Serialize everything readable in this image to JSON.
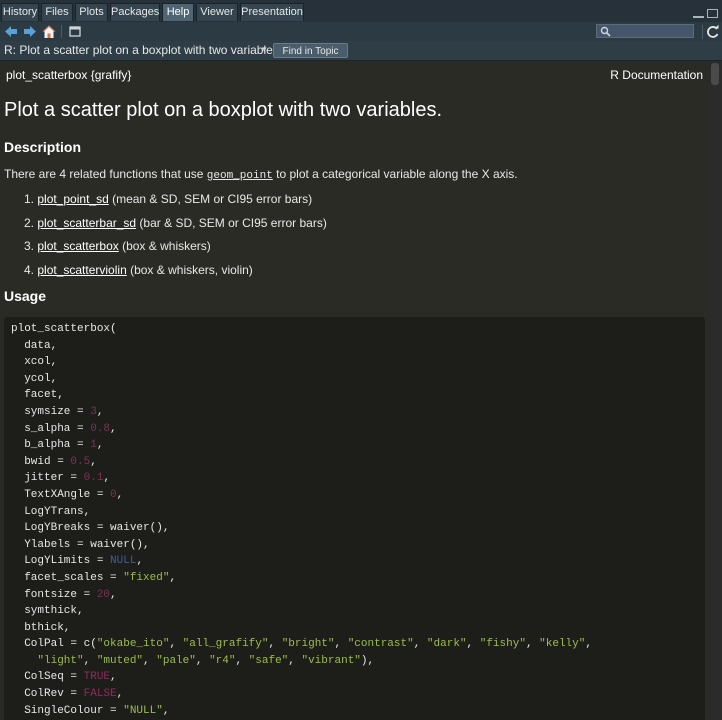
{
  "tabs": [
    {
      "label": "History",
      "active": false
    },
    {
      "label": "Files",
      "active": false
    },
    {
      "label": "Plots",
      "active": false
    },
    {
      "label": "Packages",
      "active": false
    },
    {
      "label": "Help",
      "active": true
    },
    {
      "label": "Viewer",
      "active": false
    },
    {
      "label": "Presentation",
      "active": false
    }
  ],
  "toolbar": {
    "icons": [
      "back-arrow-icon",
      "forward-arrow-icon",
      "home-icon",
      "popout-icon",
      "search-icon",
      "refresh-icon"
    ],
    "search_value": ""
  },
  "topicbar": {
    "title": "R: Plot a scatter plot on a boxplot with two variables.",
    "find_label": "Find in Topic"
  },
  "doc": {
    "topic_name": "plot_scatterbox {grafify}",
    "r_documentation": "R Documentation",
    "title": "Plot a scatter plot on a boxplot with two variables.",
    "description_heading": "Description",
    "description_pre": "There are 4 related functions that use ",
    "description_code": "geom_point",
    "description_post": " to plot a categorical variable along the X axis.",
    "items": [
      {
        "num": "1.",
        "link": "plot_point_sd",
        "text": " (mean & SD, SEM or CI95 error bars)"
      },
      {
        "num": "2.",
        "link": "plot_scatterbar_sd",
        "text": " (bar & SD, SEM or CI95 error bars)"
      },
      {
        "num": "3.",
        "link": "plot_scatterbox",
        "text": " (box & whiskers)"
      },
      {
        "num": "4.",
        "link": "plot_scatterviolin",
        "text": " (box & whiskers, violin)"
      }
    ],
    "usage_heading": "Usage"
  },
  "code": [
    [
      [
        "t",
        "plot_scatterbox("
      ]
    ],
    [
      [
        "t",
        "  data,"
      ]
    ],
    [
      [
        "t",
        "  xcol,"
      ]
    ],
    [
      [
        "t",
        "  ycol,"
      ]
    ],
    [
      [
        "t",
        "  facet,"
      ]
    ],
    [
      [
        "t",
        "  symsize = "
      ],
      [
        "num",
        "3"
      ],
      [
        "t",
        ","
      ]
    ],
    [
      [
        "t",
        "  s_alpha = "
      ],
      [
        "num",
        "0.8"
      ],
      [
        "t",
        ","
      ]
    ],
    [
      [
        "t",
        "  b_alpha = "
      ],
      [
        "num",
        "1"
      ],
      [
        "t",
        ","
      ]
    ],
    [
      [
        "t",
        "  bwid = "
      ],
      [
        "num",
        "0.5"
      ],
      [
        "t",
        ","
      ]
    ],
    [
      [
        "t",
        "  jitter = "
      ],
      [
        "num",
        "0.1"
      ],
      [
        "t",
        ","
      ]
    ],
    [
      [
        "t",
        "  TextXAngle = "
      ],
      [
        "num",
        "0"
      ],
      [
        "t",
        ","
      ]
    ],
    [
      [
        "t",
        "  LogYTrans,"
      ]
    ],
    [
      [
        "t",
        "  LogYBreaks = waiver(),"
      ]
    ],
    [
      [
        "t",
        "  Ylabels = waiver(),"
      ]
    ],
    [
      [
        "t",
        "  LogYLimits = "
      ],
      [
        "kw",
        "NULL"
      ],
      [
        "t",
        ","
      ]
    ],
    [
      [
        "t",
        "  facet_scales = "
      ],
      [
        "str",
        "\"fixed\""
      ],
      [
        "t",
        ","
      ]
    ],
    [
      [
        "t",
        "  fontsize = "
      ],
      [
        "num",
        "20"
      ],
      [
        "t",
        ","
      ]
    ],
    [
      [
        "t",
        "  symthick,"
      ]
    ],
    [
      [
        "t",
        "  bthick,"
      ]
    ],
    [
      [
        "t",
        "  ColPal = c("
      ],
      [
        "str",
        "\"okabe_ito\""
      ],
      [
        "t",
        ", "
      ],
      [
        "str",
        "\"all_grafify\""
      ],
      [
        "t",
        ", "
      ],
      [
        "str",
        "\"bright\""
      ],
      [
        "t",
        ", "
      ],
      [
        "str",
        "\"contrast\""
      ],
      [
        "t",
        ", "
      ],
      [
        "str",
        "\"dark\""
      ],
      [
        "t",
        ", "
      ],
      [
        "str",
        "\"fishy\""
      ],
      [
        "t",
        ", "
      ],
      [
        "str",
        "\"kelly\""
      ],
      [
        "t",
        ","
      ]
    ],
    [
      [
        "t",
        "    "
      ],
      [
        "str",
        "\"light\""
      ],
      [
        "t",
        ", "
      ],
      [
        "str",
        "\"muted\""
      ],
      [
        "t",
        ", "
      ],
      [
        "str",
        "\"pale\""
      ],
      [
        "t",
        ", "
      ],
      [
        "str",
        "\"r4\""
      ],
      [
        "t",
        ", "
      ],
      [
        "str",
        "\"safe\""
      ],
      [
        "t",
        ", "
      ],
      [
        "str",
        "\"vibrant\""
      ],
      [
        "t",
        "),"
      ]
    ],
    [
      [
        "t",
        "  ColSeq = "
      ],
      [
        "bool",
        "TRUE"
      ],
      [
        "t",
        ","
      ]
    ],
    [
      [
        "t",
        "  ColRev = "
      ],
      [
        "bool",
        "FALSE"
      ],
      [
        "t",
        ","
      ]
    ],
    [
      [
        "t",
        "  SingleColour = "
      ],
      [
        "str",
        "\"NULL\""
      ],
      [
        "t",
        ","
      ]
    ]
  ]
}
